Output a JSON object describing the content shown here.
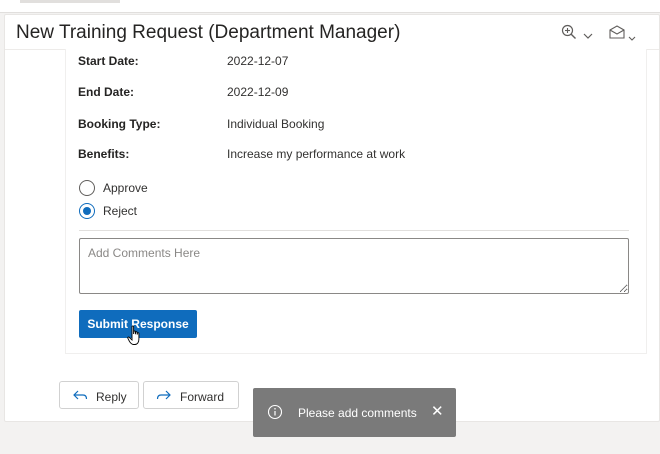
{
  "header": {
    "title": "New Training Request (Department Manager)"
  },
  "details": [
    {
      "label": "Start Date:",
      "value": "2022-12-07"
    },
    {
      "label": "End Date:",
      "value": "2022-12-09"
    },
    {
      "label": "Booking Type:",
      "value": "Individual Booking"
    },
    {
      "label": "Benefits:",
      "value": "Increase my performance at work"
    }
  ],
  "decision": {
    "options": [
      {
        "label": "Approve",
        "selected": false
      },
      {
        "label": "Reject",
        "selected": true
      }
    ]
  },
  "comments": {
    "placeholder": "Add Comments Here",
    "value": ""
  },
  "submit_label": "Submit Response",
  "actions": {
    "reply_label": "Reply",
    "forward_label": "Forward"
  },
  "toast": {
    "message": "Please add comments"
  },
  "colors": {
    "primary": "#0f6cbd",
    "toast_bg": "#7a7a7a"
  }
}
